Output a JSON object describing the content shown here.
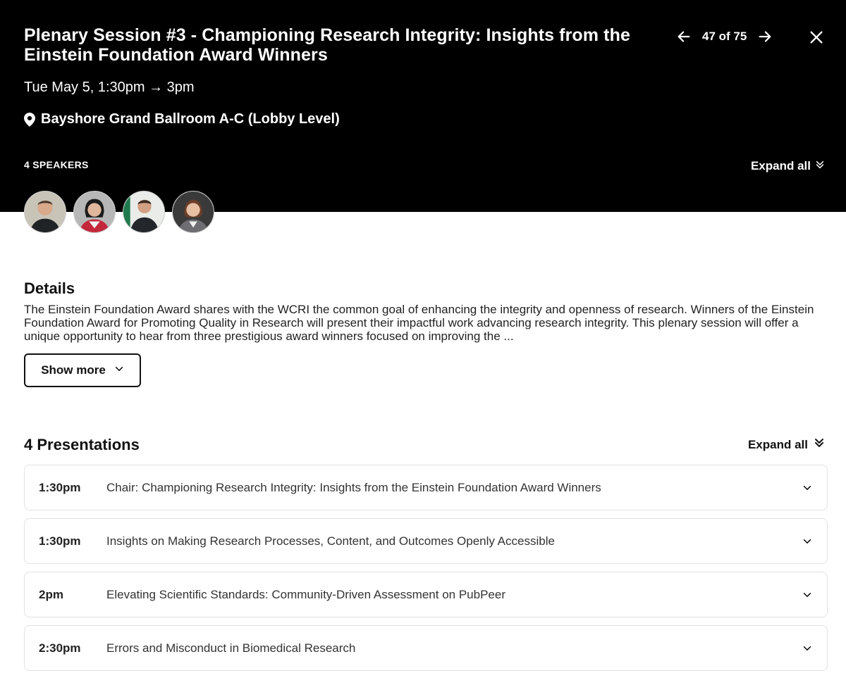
{
  "session": {
    "title": "Plenary Session #3 - Championing Research Integrity: Insights from the Einstein Foundation Award Winners",
    "datetime": "Tue May 5, 1:30pm → 3pm",
    "location": "Bayshore Grand Ballroom A-C (Lobby Level)"
  },
  "nav": {
    "position": "47 of 75",
    "prev_icon": "arrow-left-icon",
    "next_icon": "arrow-right-icon",
    "close_icon": "close-icon"
  },
  "speakers": {
    "label": "4 SPEAKERS",
    "expand_label": "Expand all",
    "avatars": [
      "speaker-1",
      "speaker-2",
      "speaker-3",
      "speaker-4"
    ]
  },
  "details": {
    "heading": "Details",
    "text": "The Einstein Foundation Award shares with the WCRI the common goal of enhancing the integrity and openness of research. Winners of the Einstein Foundation Award for Promoting Quality in Research will present their impactful work advancing research integrity. This plenary session will offer a unique opportunity to hear from three prestigious award winners focused on improving the ...",
    "show_more_label": "Show more"
  },
  "presentations": {
    "heading": "4 Presentations",
    "expand_label": "Expand all",
    "items": [
      {
        "time": "1:30pm",
        "title": "Chair: Championing Research Integrity: Insights from the Einstein Foundation Award Winners"
      },
      {
        "time": "1:30pm",
        "title": "Insights on Making Research Processes, Content, and Outcomes Openly Accessible"
      },
      {
        "time": "2pm",
        "title": "Elevating Scientific Standards: Community-Driven Assessment on PubPeer"
      },
      {
        "time": "2:30pm",
        "title": "Errors and Misconduct in Biomedical Research"
      }
    ]
  },
  "colors": {
    "header_bg": "#000000",
    "header_text": "#ffffff",
    "border": "#e2e2e2"
  }
}
